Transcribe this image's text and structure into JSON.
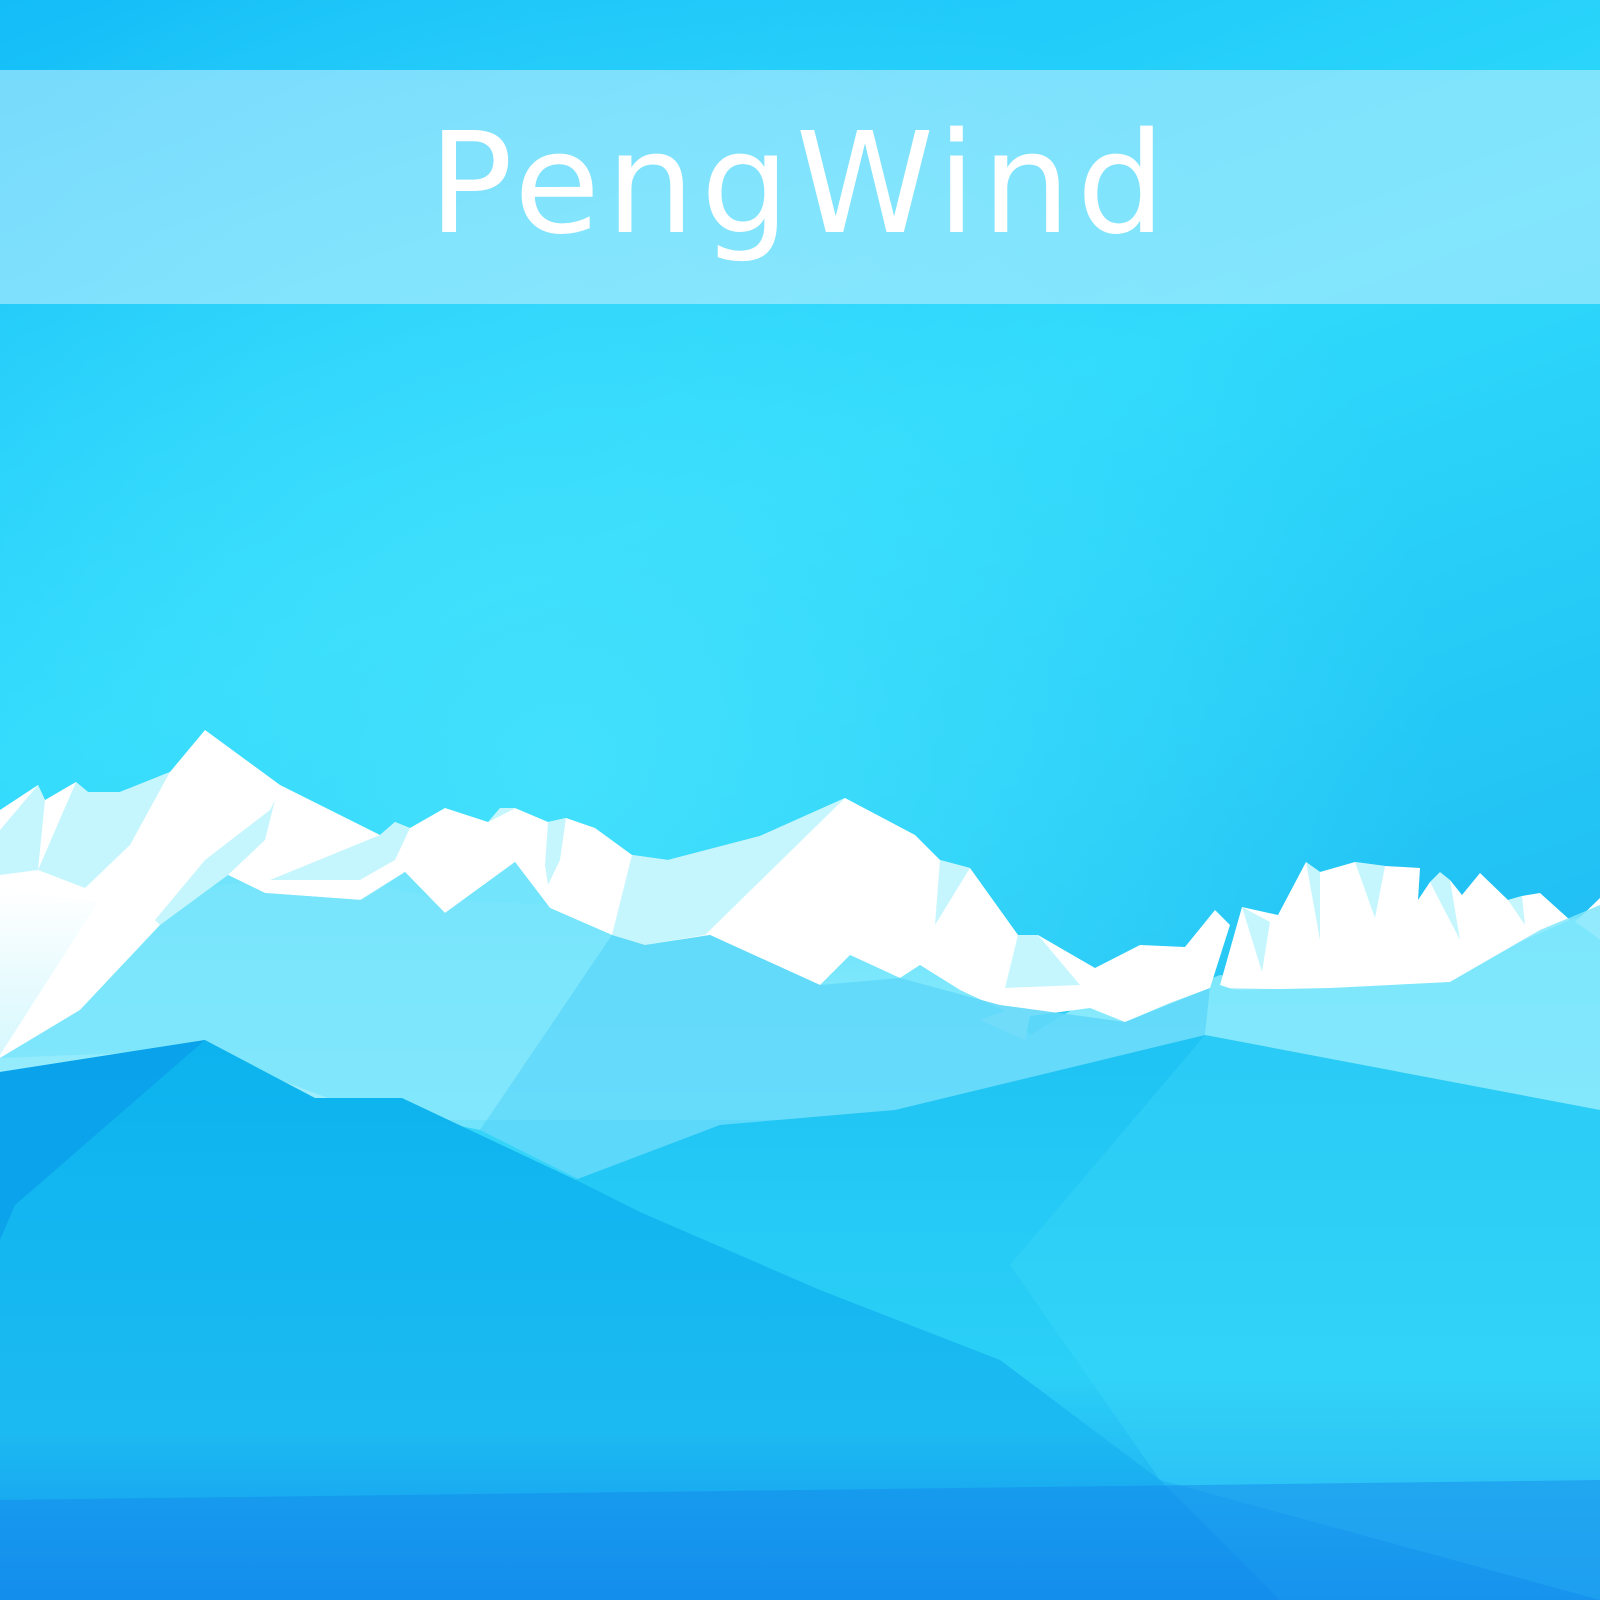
{
  "app": {
    "title": "PengWind"
  },
  "background": {
    "scene": "mountain-range-wallpaper",
    "colors": {
      "sky_top": "#14bdf8",
      "sky_glow": "#3fdcfc",
      "snow": "#ffffff",
      "snow_shadow": "#c6f6fd",
      "foreground_deep": "#0aa5ea",
      "foreground_mid": "#12bbf0",
      "band": "#c8f0ff"
    }
  }
}
